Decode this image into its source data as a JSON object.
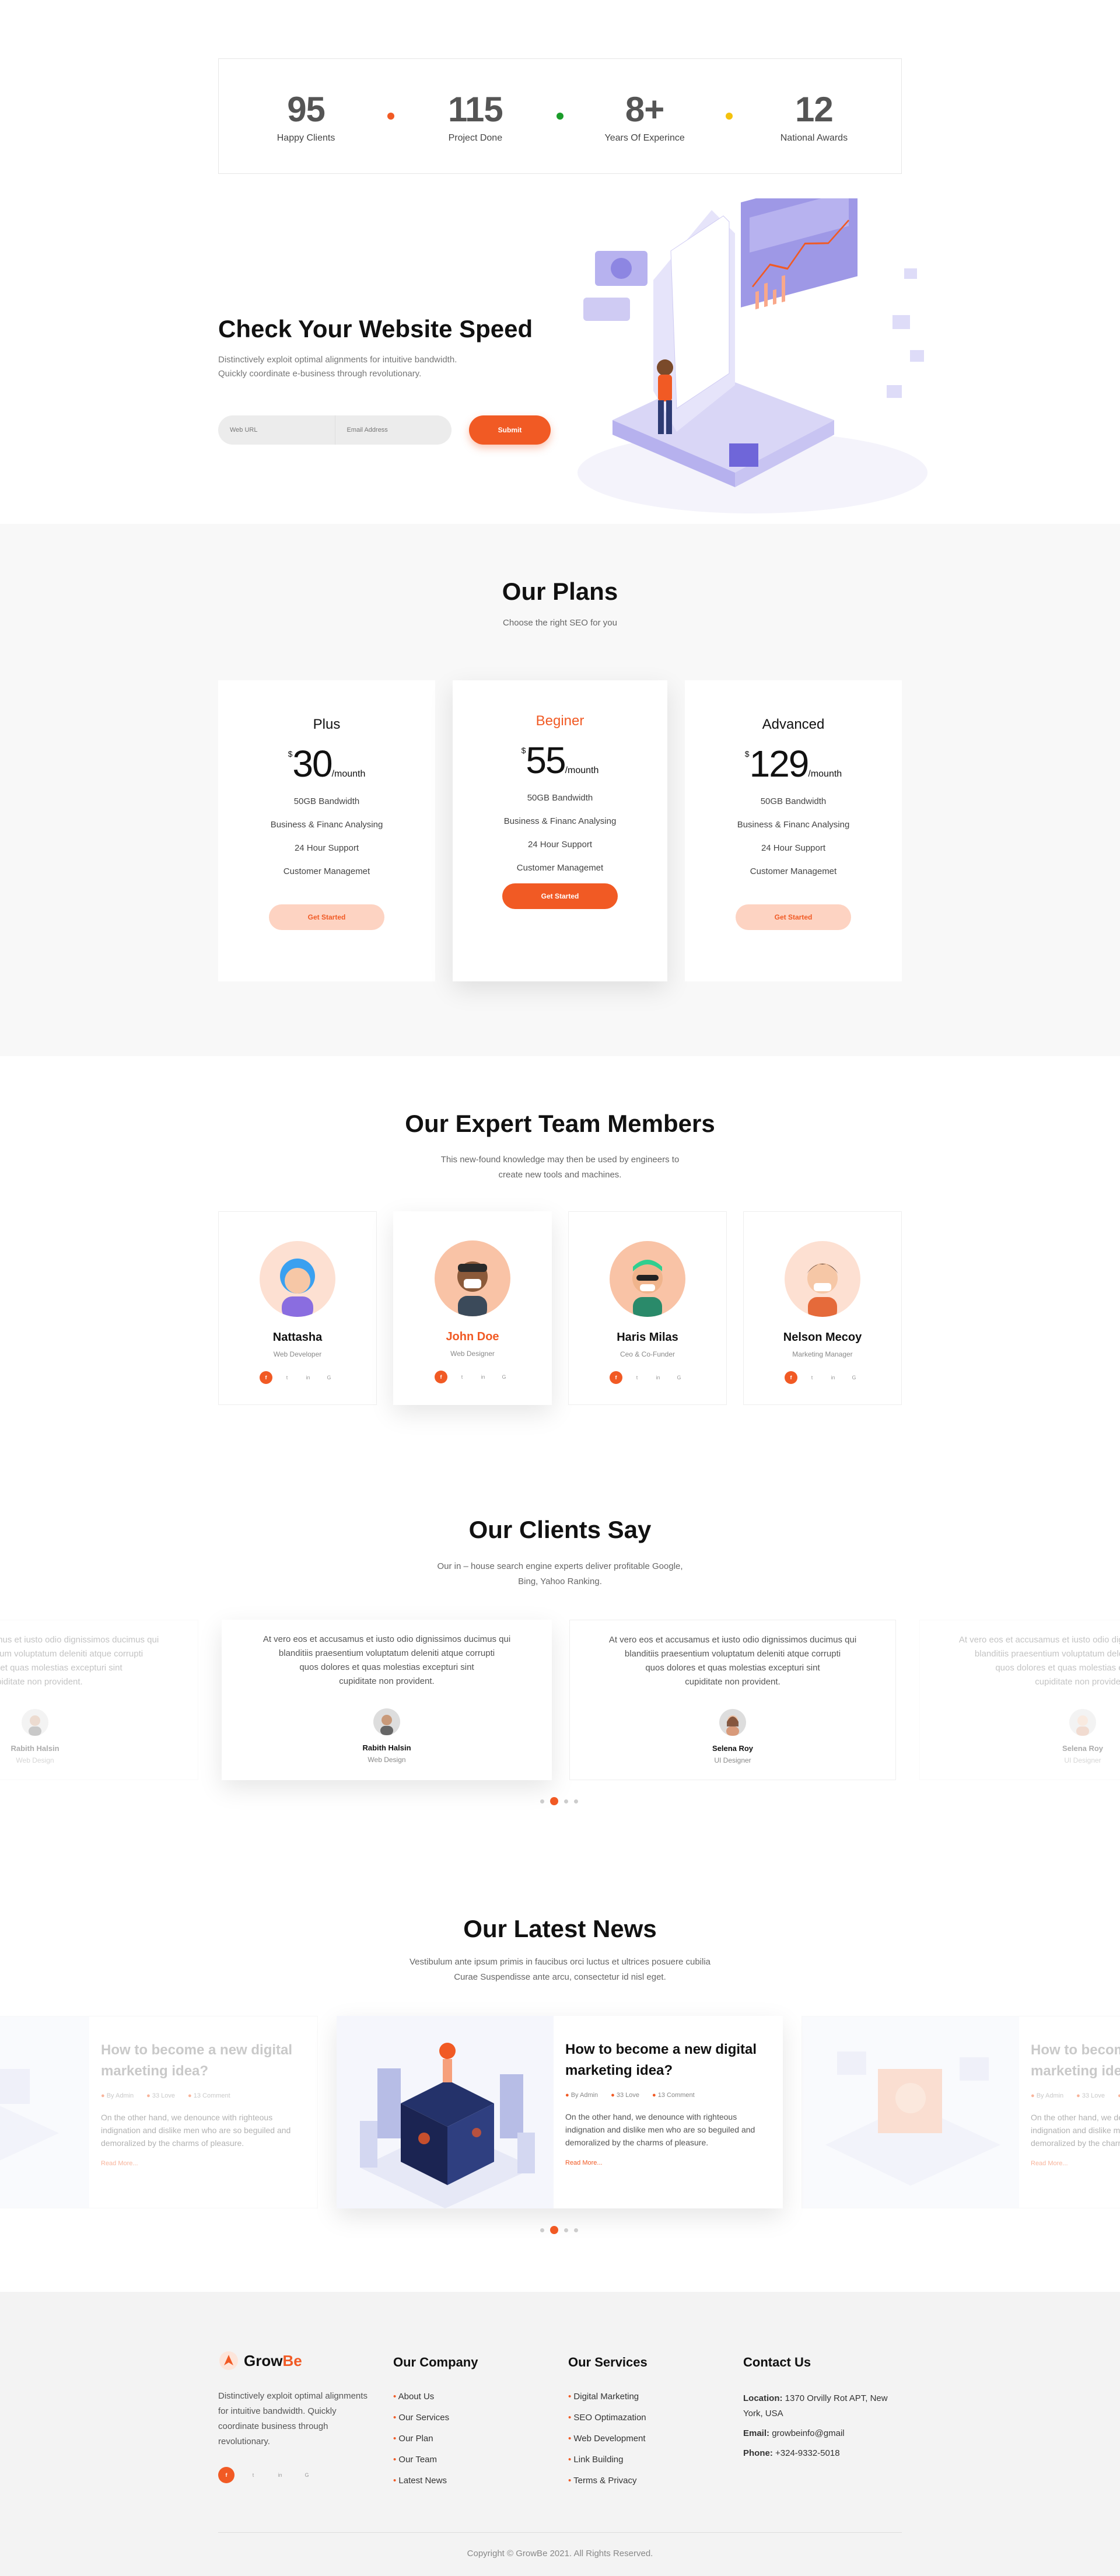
{
  "stats": [
    {
      "value": "95",
      "label": "Happy Clients",
      "dot": "#f15a24"
    },
    {
      "value": "115",
      "label": "Project Done",
      "dot": "#1a9c2a"
    },
    {
      "value": "8+",
      "label": "Years Of Experince",
      "dot": "#f4c20d"
    },
    {
      "value": "12",
      "label": "National Awards"
    }
  ],
  "speed": {
    "title": "Check Your Website Speed",
    "desc1": "Distinctively exploit optimal alignments for intuitive bandwidth.",
    "desc2": "Quickly coordinate e-business through revolutionary.",
    "url_placeholder": "Web URL",
    "email_placeholder": "Email Address",
    "submit": "Submit"
  },
  "plans": {
    "title": "Our Plans",
    "subtitle": "Choose the right SEO for you",
    "items": [
      {
        "name": "Plus",
        "currency": "$",
        "price": "30",
        "period": "/mounth",
        "features": [
          "50GB Bandwidth",
          "Business & Financ Analysing",
          "24 Hour Support",
          "Customer Managemet"
        ],
        "cta": "Get Started"
      },
      {
        "name": "Beginer",
        "currency": "$",
        "price": "55",
        "period": "/mounth",
        "features": [
          "50GB Bandwidth",
          "Business & Financ Analysing",
          "24 Hour Support",
          "Customer Managemet"
        ],
        "cta": "Get Started"
      },
      {
        "name": "Advanced",
        "currency": "$",
        "price": "129",
        "period": "/mounth",
        "features": [
          "50GB Bandwidth",
          "Business & Financ Analysing",
          "24 Hour Support",
          "Customer Managemet"
        ],
        "cta": "Get Started"
      }
    ]
  },
  "team": {
    "title": "Our Expert Team Members",
    "subtitle1": "This new-found knowledge may then be used by engineers to",
    "subtitle2": "create new tools and machines.",
    "members": [
      {
        "name": "Nattasha",
        "role": "Web Developer"
      },
      {
        "name": "John Doe",
        "role": "Web Designer"
      },
      {
        "name": "Haris Milas",
        "role": "Ceo & Co-Funder"
      },
      {
        "name": "Nelson Mecoy",
        "role": "Marketing Manager"
      }
    ]
  },
  "clients": {
    "title": "Our Clients Say",
    "subtitle1": "Our in – house search engine experts deliver profitable Google,",
    "subtitle2": "Bing, Yahoo Ranking.",
    "quote1": "At vero eos et accusamus et iusto odio dignissimos ducimus qui",
    "quote2": "blanditiis praesentium voluptatum deleniti atque corrupti",
    "quote3": "quos dolores et quas molestias excepturi sint",
    "quote4": "cupiditate non provident.",
    "items": [
      {
        "name": "Rabith Halsin",
        "role": "Web Design"
      },
      {
        "name": "Rabith Halsin",
        "role": "Web Design"
      },
      {
        "name": "Selena Roy",
        "role": "UI Designer"
      },
      {
        "name": "Selena Roy",
        "role": "UI Designer"
      }
    ]
  },
  "news": {
    "title": "Our Latest News",
    "subtitle1": "Vestibulum ante ipsum primis in faucibus orci luctus et ultrices posuere cubilia",
    "subtitle2": "Curae Suspendisse ante arcu, consectetur id nisl eget.",
    "post_title": "How to become a new digital marketing idea?",
    "author": "By Admin",
    "likes": "33 Love",
    "comments": "13 Comment",
    "excerpt": "On the other hand, we denounce with righteous indignation and dislike men who are so beguiled and demoralized by the charms of pleasure.",
    "read_more": "Read More..."
  },
  "footer": {
    "brand_a": "Grow",
    "brand_b": "Be",
    "desc": "Distinctively exploit optimal alignments for intuitive bandwidth. Quickly coordinate business through revolutionary.",
    "company_title": "Our Company",
    "company_links": [
      "About Us",
      "Our Services",
      "Our Plan",
      "Our Team",
      "Latest News"
    ],
    "services_title": "Our Services",
    "services_links": [
      "Digital Marketing",
      "SEO Optimazation",
      "Web Development",
      "Link Building",
      "Terms & Privacy"
    ],
    "contact_title": "Contact Us",
    "location_label": "Location:",
    "location": "1370 Orvilly Rot APT, New York, USA",
    "email_label": "Email:",
    "email": "growbeinfo@gmail",
    "phone_label": "Phone:",
    "phone": "+324-9332-5018",
    "copyright": "Copyright © GrowBe 2021. All Rights Reserved."
  },
  "colors": {
    "accent": "#f15a24",
    "accent_light": "#fdd3c2",
    "footer_bg": "#f3f3f3"
  }
}
